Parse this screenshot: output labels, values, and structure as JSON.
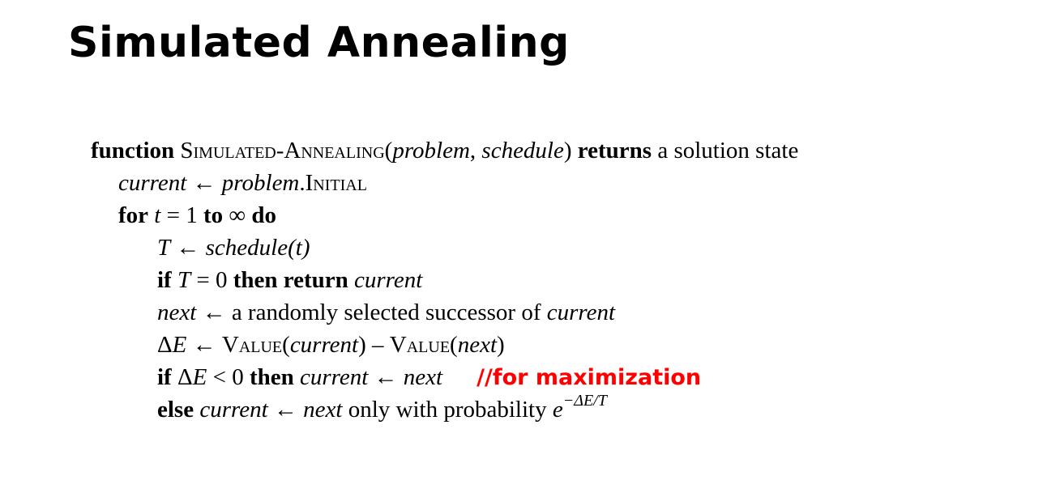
{
  "title": "Simulated Annealing",
  "comment_color": "#ff0000",
  "algorithm": {
    "l1": {
      "kw_function": "function",
      "name": "Simulated-Annealing",
      "open": "(",
      "arg1": "problem",
      "comma": ", ",
      "arg2": "schedule",
      "close": ")",
      "kw_returns": "returns",
      "rest": " a solution state"
    },
    "l2": {
      "var": "current",
      "arrow": " ← ",
      "obj": "problem",
      "dot": ".",
      "field": "Initial"
    },
    "l3": {
      "kw_for": "for",
      "var": "t",
      "eq": " = 1 ",
      "kw_to": "to",
      "inf": " ∞ ",
      "kw_do": "do"
    },
    "l4": {
      "var": "T",
      "arrow": " ← ",
      "fn": "schedule",
      "open": "(",
      "arg": "t",
      "close": ")"
    },
    "l5": {
      "kw_if": "if",
      "var": "T",
      "eq": " = 0 ",
      "kw_then_return": "then return",
      "ret": "current"
    },
    "l6": {
      "var": "next",
      "arrow": " ← ",
      "text": "a randomly selected successor of ",
      "of": "current"
    },
    "l7": {
      "delta": "Δ",
      "var": "E",
      "arrow": " ← ",
      "fn1": "Value",
      "open1": "(",
      "arg1": "current",
      "close1": ")",
      "minus": " – ",
      "fn2": "Value",
      "open2": "(",
      "arg2": "next",
      "close2": ")"
    },
    "l8": {
      "kw_if": "if",
      "delta": " Δ",
      "var": "E",
      "lt": " < 0 ",
      "kw_then": "then",
      "lhs": " current",
      "arrow": " ← ",
      "rhs": "next",
      "comment": "//for maximization"
    },
    "l9": {
      "kw_else": "else",
      "lhs": " current",
      "arrow": " ← ",
      "rhs": "next",
      "text": " only with probability ",
      "base": "e",
      "exp": "−ΔE/T"
    }
  }
}
